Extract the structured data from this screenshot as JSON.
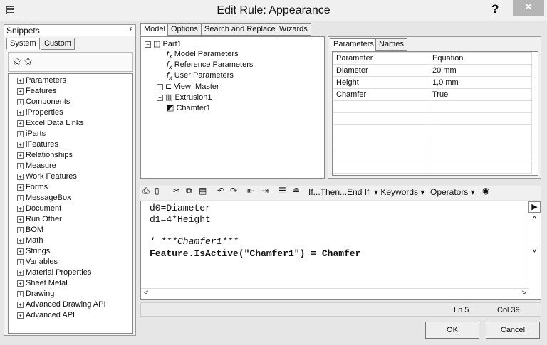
{
  "window": {
    "title": "Edit Rule: Appearance",
    "help": "?",
    "close": "✕"
  },
  "snippets": {
    "title": "Snippets",
    "pin": "ᵖ",
    "tabs": [
      "System",
      "Custom"
    ],
    "items": [
      "Parameters",
      "Features",
      "Components",
      "iProperties",
      "Excel Data Links",
      "iParts",
      "iFeatures",
      "Relationships",
      "Measure",
      "Work Features",
      "Forms",
      "MessageBox",
      "Document",
      "Run Other",
      "BOM",
      "Math",
      "Strings",
      "Variables",
      "Material Properties",
      "Sheet Metal",
      "Drawing",
      "Advanced Drawing API",
      "Advanced API"
    ]
  },
  "main_tabs": [
    "Model",
    "Options",
    "Search and Replace",
    "Wizards"
  ],
  "model_tree": {
    "root": "Part1",
    "children": [
      "Model Parameters",
      "Reference Parameters",
      "User Parameters",
      "View: Master",
      "Extrusion1",
      "Chamfer1"
    ]
  },
  "param_tabs": [
    "Parameters",
    "Names"
  ],
  "param_table": {
    "headers": [
      "Parameter",
      "Equation"
    ],
    "rows": [
      [
        "Diameter",
        "20 mm"
      ],
      [
        "Height",
        "1,0 mm"
      ],
      [
        "Chamfer",
        "True"
      ]
    ]
  },
  "toolbar": {
    "ifthen": "If...Then...End If",
    "keywords": "Keywords",
    "operators": "Operators"
  },
  "code": {
    "lines": [
      "d0=Diameter",
      "d1=4*Height",
      "",
      "' ***Chamfer1***",
      "Feature.IsActive(\"Chamfer1\") = Chamfer"
    ]
  },
  "status": {
    "ln": "Ln 5",
    "col": "Col 39"
  },
  "buttons": {
    "ok": "OK",
    "cancel": "Cancel"
  }
}
